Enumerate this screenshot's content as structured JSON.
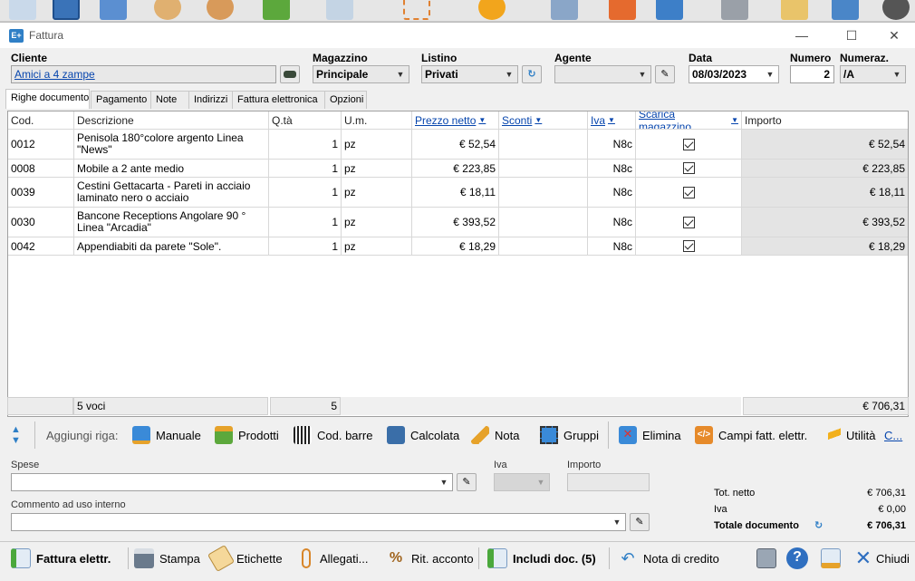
{
  "window": {
    "title": "Fattura",
    "app_badge": "E+"
  },
  "header": {
    "cliente_label": "Cliente",
    "cliente_value": "Amici a 4 zampe",
    "magazzino_label": "Magazzino",
    "magazzino_value": "Principale",
    "listino_label": "Listino",
    "listino_value": "Privati",
    "agente_label": "Agente",
    "agente_value": "",
    "data_label": "Data",
    "data_value": "08/03/2023",
    "numero_label": "Numero",
    "numero_value": "2",
    "numeraz_label": "Numeraz.",
    "numeraz_value": "/A"
  },
  "tabs": [
    {
      "label": "Righe documento",
      "active": true
    },
    {
      "label": "Pagamento"
    },
    {
      "label": "Note"
    },
    {
      "label": "Indirizzi"
    },
    {
      "label": "Fattura elettronica"
    },
    {
      "label": "Opzioni"
    }
  ],
  "grid": {
    "columns": [
      "Cod.",
      "Descrizione",
      "Q.tà",
      "U.m.",
      "Prezzo netto",
      "Sconti",
      "Iva",
      "Scarica magazzino",
      "Importo"
    ],
    "rows": [
      {
        "cod": "0012",
        "desc": "Penisola 180°colore argento Linea \"News\"",
        "qta": "1",
        "um": "pz",
        "prezzo": "€ 52,54",
        "sconti": "",
        "iva": "N8c",
        "scarica": true,
        "importo": "€ 52,54"
      },
      {
        "cod": "0008",
        "desc": "Mobile a 2 ante medio",
        "qta": "1",
        "um": "pz",
        "prezzo": "€ 223,85",
        "sconti": "",
        "iva": "N8c",
        "scarica": true,
        "importo": "€ 223,85"
      },
      {
        "cod": "0039",
        "desc": "Cestini Gettacarta - Pareti in acciaio laminato nero o acciaio",
        "qta": "1",
        "um": "pz",
        "prezzo": "€ 18,11",
        "sconti": "",
        "iva": "N8c",
        "scarica": true,
        "importo": "€ 18,11"
      },
      {
        "cod": "0030",
        "desc": "Bancone Receptions Angolare 90 ° Linea \"Arcadia\"",
        "qta": "1",
        "um": "pz",
        "prezzo": "€ 393,52",
        "sconti": "",
        "iva": "N8c",
        "scarica": true,
        "importo": "€ 393,52"
      },
      {
        "cod": "0042",
        "desc": "Appendiabiti da parete \"Sole\".",
        "qta": "1",
        "um": "pz",
        "prezzo": "€ 18,29",
        "sconti": "",
        "iva": "N8c",
        "scarica": true,
        "importo": "€ 18,29"
      }
    ],
    "footer": {
      "voci": "5 voci",
      "qta_total": "5",
      "importo_total": "€ 706,31"
    }
  },
  "addbar": {
    "label": "Aggiungi riga:",
    "manuale": "Manuale",
    "prodotti": "Prodotti",
    "cod_barre": "Cod. barre",
    "calcolata": "Calcolata",
    "nota": "Nota",
    "gruppi": "Gruppi",
    "elimina": "Elimina",
    "campi": "Campi fatt. elettr.",
    "utilita": "Utilità",
    "more": "C..."
  },
  "bottom": {
    "spese_label": "Spese",
    "spese_value": "",
    "iva_label": "Iva",
    "importo_label": "Importo",
    "commento_label": "Commento ad uso interno",
    "commento_value": "",
    "tot_netto_label": "Tot. netto",
    "tot_netto_value": "€ 706,31",
    "iva_tot_label": "Iva",
    "iva_tot_value": "€ 0,00",
    "totale_label": "Totale documento",
    "totale_value": "€ 706,31"
  },
  "buttons": {
    "fattura_elettr": "Fattura elettr.",
    "stampa": "Stampa",
    "etichette": "Etichette",
    "allegati": "Allegati...",
    "rit_acconto": "Rit. acconto",
    "includi_doc": "Includi doc. (5)",
    "nota_credito": "Nota di credito",
    "chiudi": "Chiudi"
  },
  "colors": {
    "link": "#0645ad",
    "accent": "#2f7fc6"
  }
}
